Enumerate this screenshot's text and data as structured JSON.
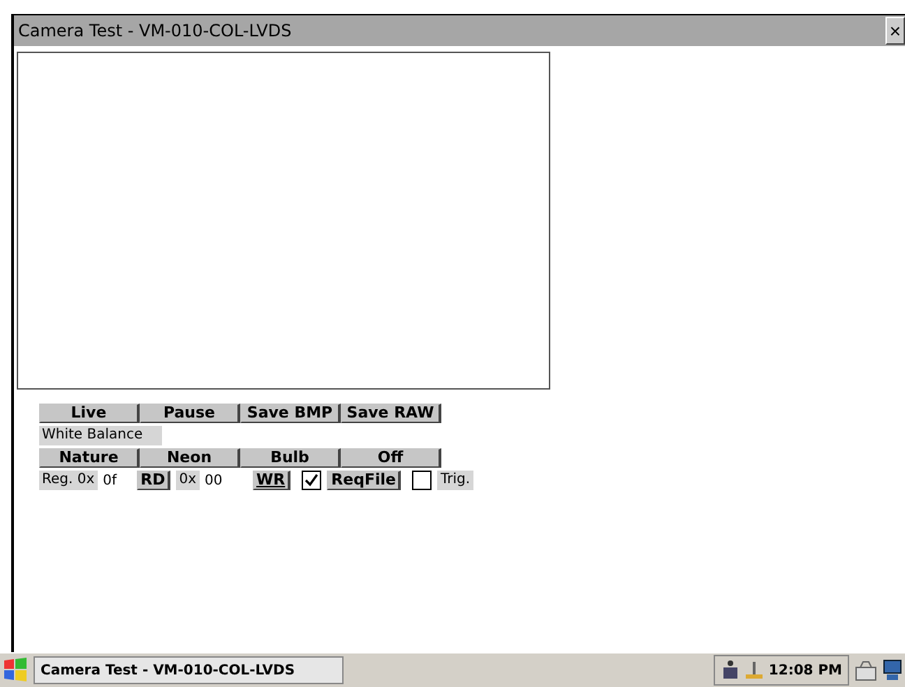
{
  "window": {
    "title": "Camera Test - VM-010-COL-LVDS",
    "close": "×"
  },
  "capture_buttons": [
    "Live",
    "Pause",
    "Save BMP",
    "Save RAW"
  ],
  "white_balance": {
    "label": "White Balance",
    "buttons": [
      "Nature",
      "Neon",
      "Bulb",
      "Off"
    ]
  },
  "register": {
    "address_label": "Reg. 0x",
    "address_value": "0f",
    "read_button": "RD",
    "data_label": "0x",
    "data_value": "00",
    "write_button": "WR",
    "reqfile": {
      "checked": true,
      "button": "ReqFile"
    },
    "trig": {
      "checked": false,
      "label": "Trig."
    }
  },
  "taskbar": {
    "task": "Camera Test - VM-010-COL-LVDS",
    "time": "12:08 PM"
  }
}
